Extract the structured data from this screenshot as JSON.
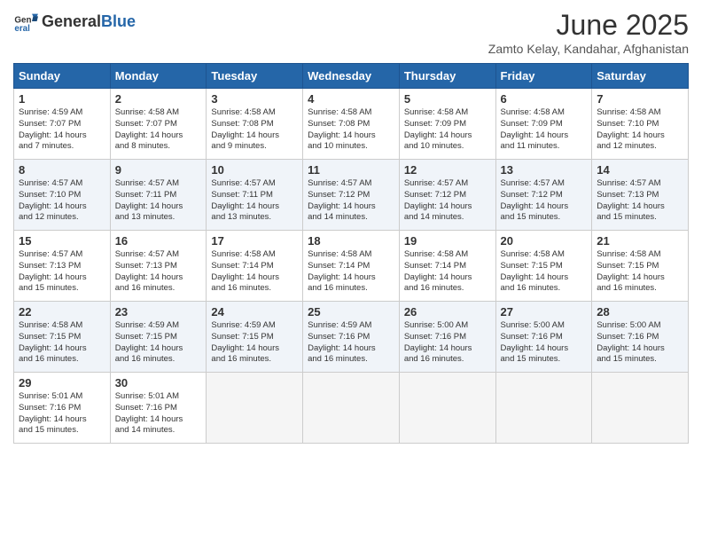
{
  "header": {
    "logo_general": "General",
    "logo_blue": "Blue",
    "month_title": "June 2025",
    "location": "Zamto Kelay, Kandahar, Afghanistan"
  },
  "days_of_week": [
    "Sunday",
    "Monday",
    "Tuesday",
    "Wednesday",
    "Thursday",
    "Friday",
    "Saturday"
  ],
  "weeks": [
    [
      {
        "day": 1,
        "lines": [
          "Sunrise: 4:59 AM",
          "Sunset: 7:07 PM",
          "Daylight: 14 hours",
          "and 7 minutes."
        ]
      },
      {
        "day": 2,
        "lines": [
          "Sunrise: 4:58 AM",
          "Sunset: 7:07 PM",
          "Daylight: 14 hours",
          "and 8 minutes."
        ]
      },
      {
        "day": 3,
        "lines": [
          "Sunrise: 4:58 AM",
          "Sunset: 7:08 PM",
          "Daylight: 14 hours",
          "and 9 minutes."
        ]
      },
      {
        "day": 4,
        "lines": [
          "Sunrise: 4:58 AM",
          "Sunset: 7:08 PM",
          "Daylight: 14 hours",
          "and 10 minutes."
        ]
      },
      {
        "day": 5,
        "lines": [
          "Sunrise: 4:58 AM",
          "Sunset: 7:09 PM",
          "Daylight: 14 hours",
          "and 10 minutes."
        ]
      },
      {
        "day": 6,
        "lines": [
          "Sunrise: 4:58 AM",
          "Sunset: 7:09 PM",
          "Daylight: 14 hours",
          "and 11 minutes."
        ]
      },
      {
        "day": 7,
        "lines": [
          "Sunrise: 4:58 AM",
          "Sunset: 7:10 PM",
          "Daylight: 14 hours",
          "and 12 minutes."
        ]
      }
    ],
    [
      {
        "day": 8,
        "lines": [
          "Sunrise: 4:57 AM",
          "Sunset: 7:10 PM",
          "Daylight: 14 hours",
          "and 12 minutes."
        ]
      },
      {
        "day": 9,
        "lines": [
          "Sunrise: 4:57 AM",
          "Sunset: 7:11 PM",
          "Daylight: 14 hours",
          "and 13 minutes."
        ]
      },
      {
        "day": 10,
        "lines": [
          "Sunrise: 4:57 AM",
          "Sunset: 7:11 PM",
          "Daylight: 14 hours",
          "and 13 minutes."
        ]
      },
      {
        "day": 11,
        "lines": [
          "Sunrise: 4:57 AM",
          "Sunset: 7:12 PM",
          "Daylight: 14 hours",
          "and 14 minutes."
        ]
      },
      {
        "day": 12,
        "lines": [
          "Sunrise: 4:57 AM",
          "Sunset: 7:12 PM",
          "Daylight: 14 hours",
          "and 14 minutes."
        ]
      },
      {
        "day": 13,
        "lines": [
          "Sunrise: 4:57 AM",
          "Sunset: 7:12 PM",
          "Daylight: 14 hours",
          "and 15 minutes."
        ]
      },
      {
        "day": 14,
        "lines": [
          "Sunrise: 4:57 AM",
          "Sunset: 7:13 PM",
          "Daylight: 14 hours",
          "and 15 minutes."
        ]
      }
    ],
    [
      {
        "day": 15,
        "lines": [
          "Sunrise: 4:57 AM",
          "Sunset: 7:13 PM",
          "Daylight: 14 hours",
          "and 15 minutes."
        ]
      },
      {
        "day": 16,
        "lines": [
          "Sunrise: 4:57 AM",
          "Sunset: 7:13 PM",
          "Daylight: 14 hours",
          "and 16 minutes."
        ]
      },
      {
        "day": 17,
        "lines": [
          "Sunrise: 4:58 AM",
          "Sunset: 7:14 PM",
          "Daylight: 14 hours",
          "and 16 minutes."
        ]
      },
      {
        "day": 18,
        "lines": [
          "Sunrise: 4:58 AM",
          "Sunset: 7:14 PM",
          "Daylight: 14 hours",
          "and 16 minutes."
        ]
      },
      {
        "day": 19,
        "lines": [
          "Sunrise: 4:58 AM",
          "Sunset: 7:14 PM",
          "Daylight: 14 hours",
          "and 16 minutes."
        ]
      },
      {
        "day": 20,
        "lines": [
          "Sunrise: 4:58 AM",
          "Sunset: 7:15 PM",
          "Daylight: 14 hours",
          "and 16 minutes."
        ]
      },
      {
        "day": 21,
        "lines": [
          "Sunrise: 4:58 AM",
          "Sunset: 7:15 PM",
          "Daylight: 14 hours",
          "and 16 minutes."
        ]
      }
    ],
    [
      {
        "day": 22,
        "lines": [
          "Sunrise: 4:58 AM",
          "Sunset: 7:15 PM",
          "Daylight: 14 hours",
          "and 16 minutes."
        ]
      },
      {
        "day": 23,
        "lines": [
          "Sunrise: 4:59 AM",
          "Sunset: 7:15 PM",
          "Daylight: 14 hours",
          "and 16 minutes."
        ]
      },
      {
        "day": 24,
        "lines": [
          "Sunrise: 4:59 AM",
          "Sunset: 7:15 PM",
          "Daylight: 14 hours",
          "and 16 minutes."
        ]
      },
      {
        "day": 25,
        "lines": [
          "Sunrise: 4:59 AM",
          "Sunset: 7:16 PM",
          "Daylight: 14 hours",
          "and 16 minutes."
        ]
      },
      {
        "day": 26,
        "lines": [
          "Sunrise: 5:00 AM",
          "Sunset: 7:16 PM",
          "Daylight: 14 hours",
          "and 16 minutes."
        ]
      },
      {
        "day": 27,
        "lines": [
          "Sunrise: 5:00 AM",
          "Sunset: 7:16 PM",
          "Daylight: 14 hours",
          "and 15 minutes."
        ]
      },
      {
        "day": 28,
        "lines": [
          "Sunrise: 5:00 AM",
          "Sunset: 7:16 PM",
          "Daylight: 14 hours",
          "and 15 minutes."
        ]
      }
    ],
    [
      {
        "day": 29,
        "lines": [
          "Sunrise: 5:01 AM",
          "Sunset: 7:16 PM",
          "Daylight: 14 hours",
          "and 15 minutes."
        ]
      },
      {
        "day": 30,
        "lines": [
          "Sunrise: 5:01 AM",
          "Sunset: 7:16 PM",
          "Daylight: 14 hours",
          "and 14 minutes."
        ]
      },
      null,
      null,
      null,
      null,
      null
    ]
  ]
}
